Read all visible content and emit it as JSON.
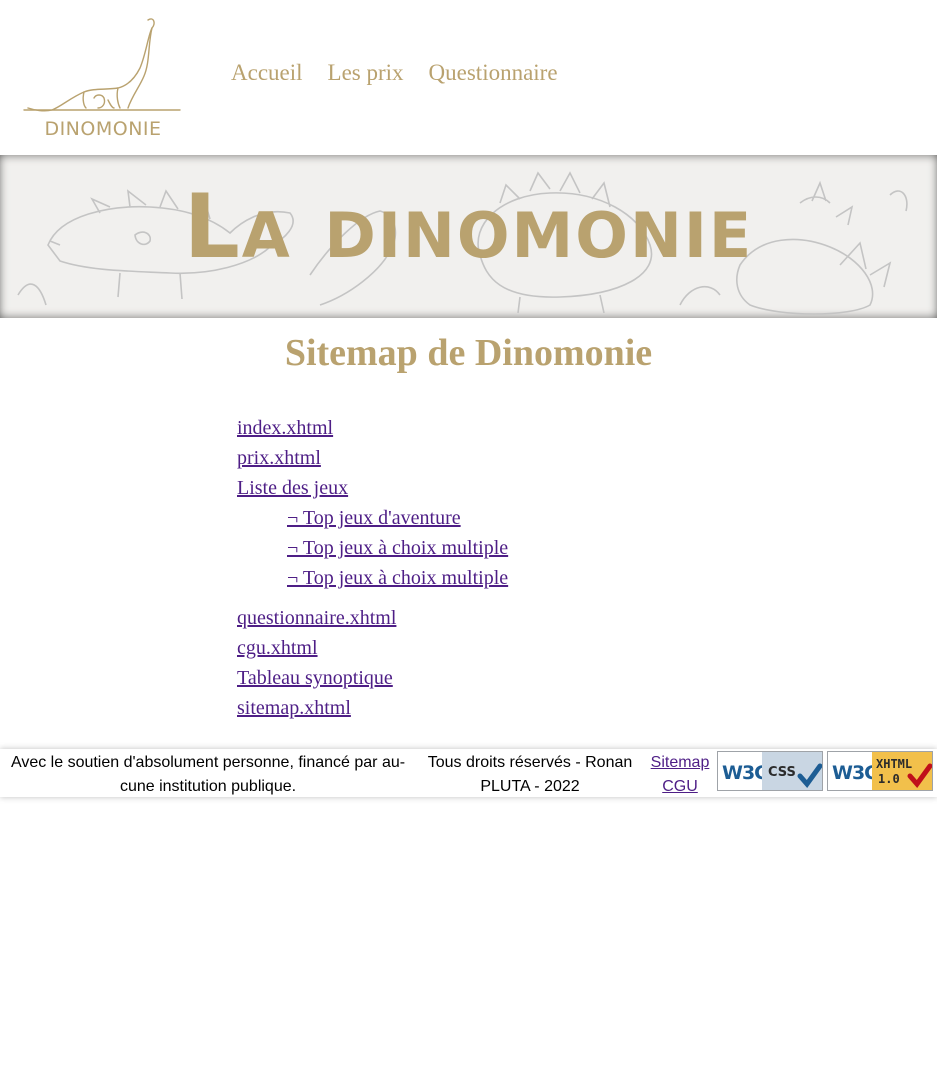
{
  "header": {
    "logo_text": "DINOMONIE",
    "nav": [
      {
        "label": "Accueil"
      },
      {
        "label": "Les prix"
      },
      {
        "label": "Questionnaire"
      }
    ]
  },
  "banner": {
    "title": "La dinomonie"
  },
  "main": {
    "title": "Sitemap de Dinomonie",
    "links": [
      {
        "label": "index.xhtml"
      },
      {
        "label": "prix.xhtml"
      },
      {
        "label": "Liste des jeux"
      }
    ],
    "sub_links": [
      {
        "label": "¬ Top jeux d'aventure"
      },
      {
        "label": "¬ Top jeux à choix multiple"
      },
      {
        "label": "¬ Top jeux à choix multiple"
      }
    ],
    "links_after": [
      {
        "label": "questionnaire.xhtml"
      },
      {
        "label": "cgu.xhtml"
      },
      {
        "label": "Tableau synoptique"
      },
      {
        "label": "sitemap.xhtml"
      }
    ]
  },
  "footer": {
    "left_text": "Avec le soutien d'absolument personne, financé par au-cune institution publique.",
    "center_text": "Tous droits réservés - Ronan PLUTA - 2022",
    "sitemap_link": "Sitemap",
    "cgu_link": "CGU",
    "css_badge": {
      "w3c": "W3C",
      "label": "CSS"
    },
    "xhtml_badge": {
      "w3c": "W3C",
      "label": "XHTML",
      "version": "1.0"
    }
  },
  "colors": {
    "accent": "#b9a26f",
    "link": "#4e1e86",
    "banner_bg": "#f1f0ee"
  }
}
